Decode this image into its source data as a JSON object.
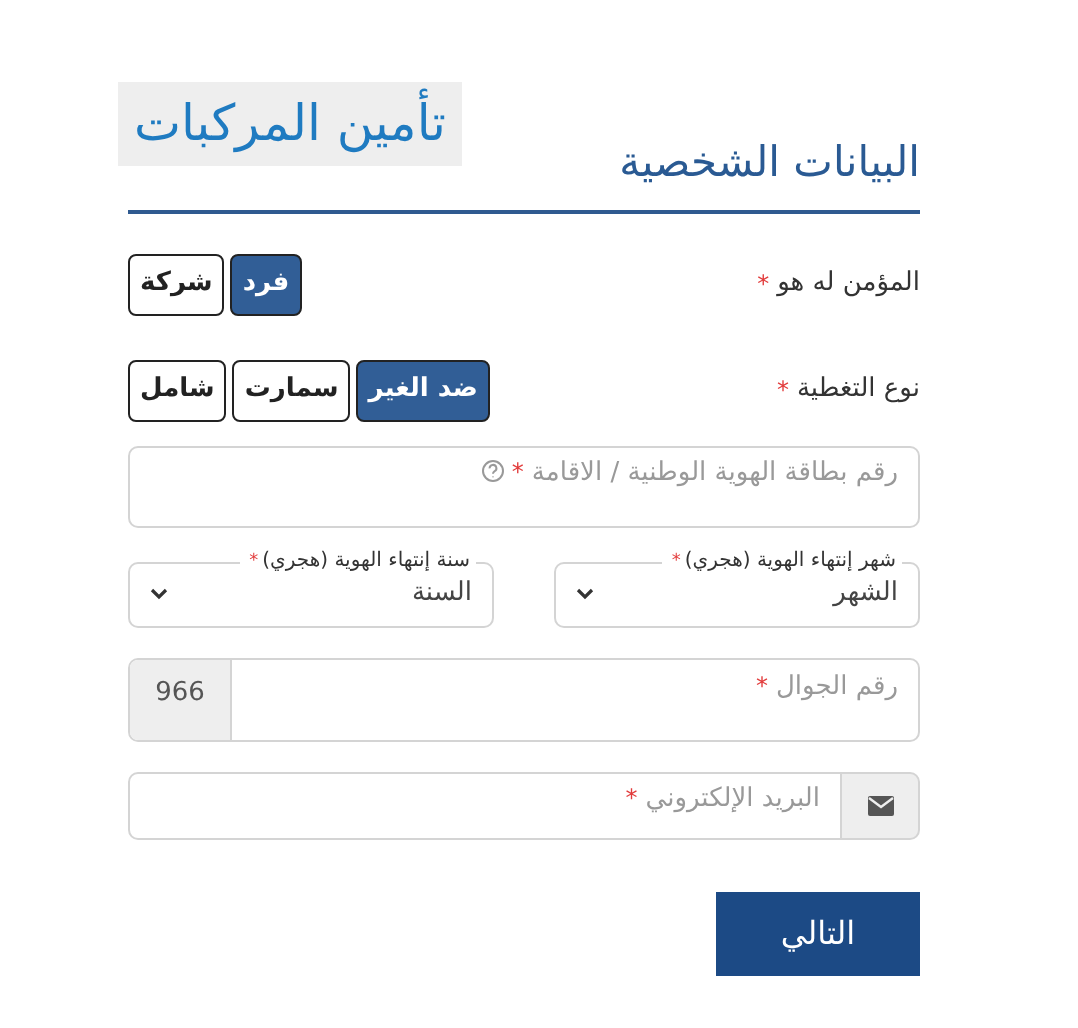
{
  "banner": {
    "title": "تأمين المركبات"
  },
  "section": {
    "title": "البيانات الشخصية"
  },
  "option_groups": [
    {
      "label": "المؤمن له هو",
      "required_mark": "*",
      "options": [
        {
          "label": "فرد",
          "selected": true
        },
        {
          "label": "شركة",
          "selected": false
        }
      ]
    },
    {
      "label": "نوع التغطية",
      "required_mark": "*",
      "options": [
        {
          "label": "ضد الغير",
          "selected": true
        },
        {
          "label": "سمارت",
          "selected": false
        },
        {
          "label": "شامل",
          "selected": false
        }
      ]
    }
  ],
  "id_field": {
    "placeholder": "رقم بطاقة الهوية الوطنية / الاقامة",
    "required_mark": "*",
    "help_icon": true
  },
  "selects": [
    {
      "label": "شهر إنتهاء الهوية (هجري)",
      "required_mark": "*",
      "value": "الشهر"
    },
    {
      "label": "سنة إنتهاء الهوية (هجري)",
      "required_mark": "*",
      "value": "السنة"
    }
  ],
  "phone_field": {
    "placeholder": "رقم الجوال",
    "required_mark": "*",
    "prefix": "966"
  },
  "email_field": {
    "placeholder": "البريد الإلكتروني",
    "required_mark": "*"
  },
  "next_button": {
    "label": "التالي"
  }
}
